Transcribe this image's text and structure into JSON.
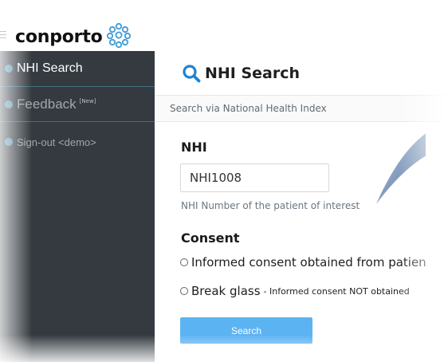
{
  "brand": {
    "name": "conporto",
    "logo_icon": "molecule-icon",
    "accent": "#3e9ad6"
  },
  "sidebar": {
    "items": [
      {
        "label": "NHI Search",
        "icon": "circle-icon"
      },
      {
        "label": "Feedback",
        "tag": "[New]",
        "icon": "circle-icon"
      },
      {
        "label": "Sign-out <demo>",
        "icon": "circle-icon"
      }
    ]
  },
  "main": {
    "title": "NHI Search",
    "title_icon": "search-icon",
    "subtitle": "Search via National Health Index"
  },
  "form": {
    "nhi_label": "NHI",
    "nhi_value": "NHI1008",
    "nhi_help": "NHI Number of the patient of interest",
    "consent_label": "Consent",
    "consent_options": [
      {
        "label": "Informed consent obtained from patien",
        "aside": ""
      },
      {
        "label": "Break glass",
        "aside": "- Informed consent NOT obtained"
      }
    ],
    "search_button": "Search",
    "button_color": "#5cb3f2"
  }
}
